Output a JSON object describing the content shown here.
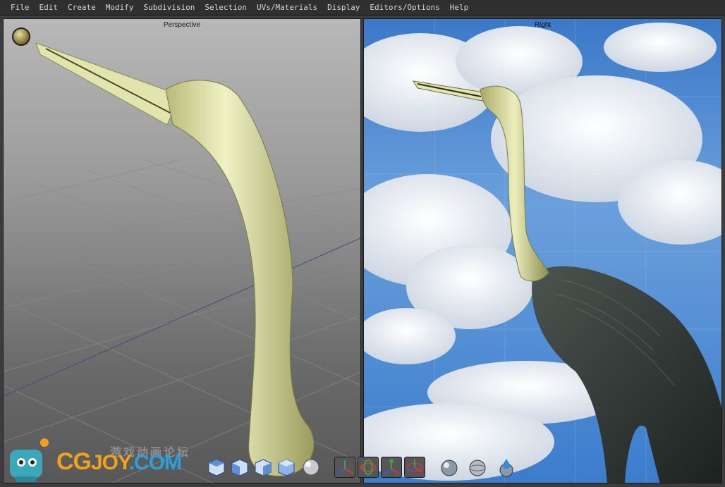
{
  "menu": [
    "File",
    "Edit",
    "Create",
    "Modify",
    "Subdivision",
    "Selection",
    "UVs/Materials",
    "Display",
    "Editors/Options",
    "Help"
  ],
  "viewports": {
    "left_title": "Perspective",
    "right_title": "Right"
  },
  "watermark": {
    "chinese": "游戏动画论坛",
    "cg": "CG",
    "joy": "JOY",
    "com": ".COM"
  },
  "colors": {
    "model": "#e6e8b0",
    "sky": "#3b78c8",
    "menubar": "#2f2f2f",
    "logo_orange": "#f0a21c",
    "logo_blue": "#2a9fd8"
  },
  "toolbar_icons": [
    "cube-top-icon",
    "cube-front-icon",
    "cube-side-icon",
    "cube-persp-icon",
    "sphere-icon",
    "axis-move-icon",
    "axis-rotate-icon",
    "axis-scale-icon",
    "axis-universal-icon",
    "shade-icon",
    "wire-icon",
    "texture-drop-icon"
  ]
}
